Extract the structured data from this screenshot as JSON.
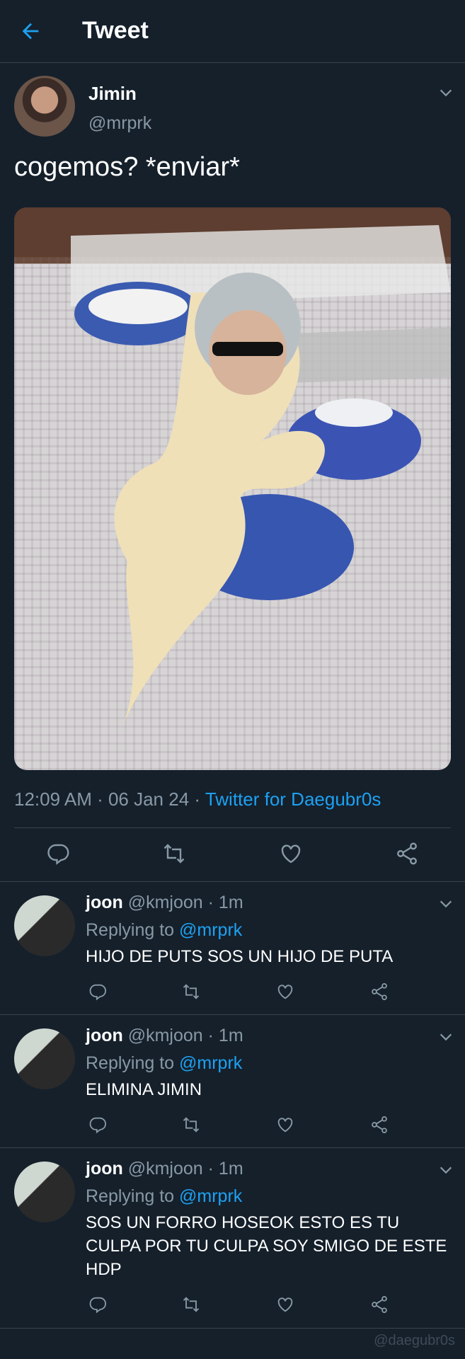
{
  "header": {
    "title": "Tweet",
    "back_icon": "arrow-left-icon"
  },
  "tweet": {
    "author_name": "Jimin",
    "author_handle": "@mrprk",
    "text": "cogemos? *enviar*",
    "time": "12:09 AM · 06 Jan 24 · ",
    "source": "Twitter for Daegubr0s"
  },
  "actions": [
    "reply-icon",
    "retweet-icon",
    "like-icon",
    "share-icon"
  ],
  "replies": [
    {
      "name": "joon",
      "handle": "@kmjoon",
      "age": " · 1m",
      "replying_prefix": "Replying to ",
      "replying_to": "@mrprk",
      "text": "HIJO DE PUTS SOS UN HIJO DE PUTA"
    },
    {
      "name": "joon",
      "handle": "@kmjoon",
      "age": " · 1m",
      "replying_prefix": "Replying to ",
      "replying_to": "@mrprk",
      "text": "ELIMINA JIMIN"
    },
    {
      "name": "joon",
      "handle": "@kmjoon",
      "age": " · 1m",
      "replying_prefix": "Replying to ",
      "replying_to": "@mrprk",
      "text": "SOS UN FORRO HOSEOK ESTO ES TU CULPA POR TU CULPA SOY SMIGO DE ESTE HDP"
    }
  ],
  "watermark": "@daegubr0s",
  "colors": {
    "background": "#15202b",
    "accent": "#1da1f2",
    "muted": "#8899a6",
    "divider": "#38444d"
  }
}
